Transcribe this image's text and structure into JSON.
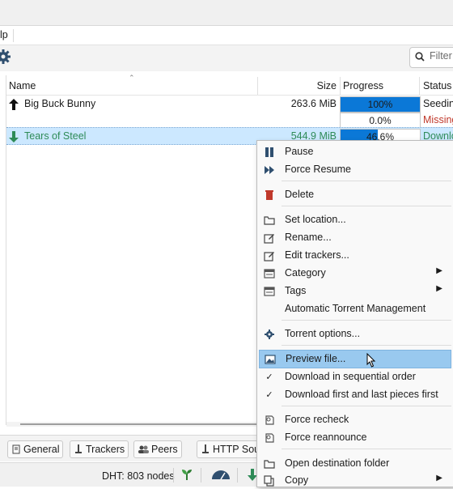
{
  "menubar": {
    "help_label": "lp"
  },
  "toolbar": {
    "filter_placeholder": "Filter"
  },
  "table": {
    "columns": {
      "name": "Name",
      "size": "Size",
      "progress": "Progress",
      "status": "Status"
    },
    "rows": [
      {
        "name": "Big Buck Bunny",
        "size": "263.6 MiB",
        "progress_label": "100%",
        "progress": 1.0,
        "status": "Seeding",
        "status_color": "#1b1b1b",
        "direction": "up"
      },
      {
        "name": "",
        "size": "",
        "progress_label": "0.0%",
        "progress": 0.0,
        "status": "Missing Files",
        "status_color": "#c0392b",
        "direction": "none"
      },
      {
        "name": "Tears of Steel",
        "size": "544.9 MiB",
        "progress_label": "46.6%",
        "progress": 0.466,
        "status": "Downloading",
        "status_color": "#2e8b57",
        "direction": "down"
      }
    ]
  },
  "tabs": {
    "general": "General",
    "trackers": "Trackers",
    "peers": "Peers",
    "http_sources": "HTTP Sources"
  },
  "statusbar": {
    "dht": "DHT: 803 nodes"
  },
  "context_menu": {
    "pause": "Pause",
    "force_resume": "Force Resume",
    "delete": "Delete",
    "set_location": "Set location...",
    "rename": "Rename...",
    "edit_trackers": "Edit trackers...",
    "category": "Category",
    "tags": "Tags",
    "atm": "Automatic Torrent Management",
    "torrent_options": "Torrent options...",
    "preview_file": "Preview file...",
    "sequential": "Download in sequential order",
    "first_last": "Download first and last pieces first",
    "force_recheck": "Force recheck",
    "force_reannounce": "Force reannounce",
    "open_destination": "Open destination folder",
    "copy": "Copy"
  },
  "colors": {
    "accent": "#0b78d7",
    "selection": "#cce8ff",
    "menu_hover": "#99c9ef",
    "downloading": "#2e8b57",
    "missing": "#c0392b"
  },
  "icons": [
    "gear-icon",
    "search-icon",
    "upload-arrow-icon",
    "download-arrow-icon",
    "pause-icon",
    "fast-forward-icon",
    "trash-icon",
    "folder-icon",
    "edit-icon",
    "list-icon",
    "settings-icon",
    "image-icon",
    "check-icon",
    "recheck-icon",
    "plant-icon",
    "speedometer-icon",
    "download-icon",
    "mouse-cursor-icon"
  ]
}
